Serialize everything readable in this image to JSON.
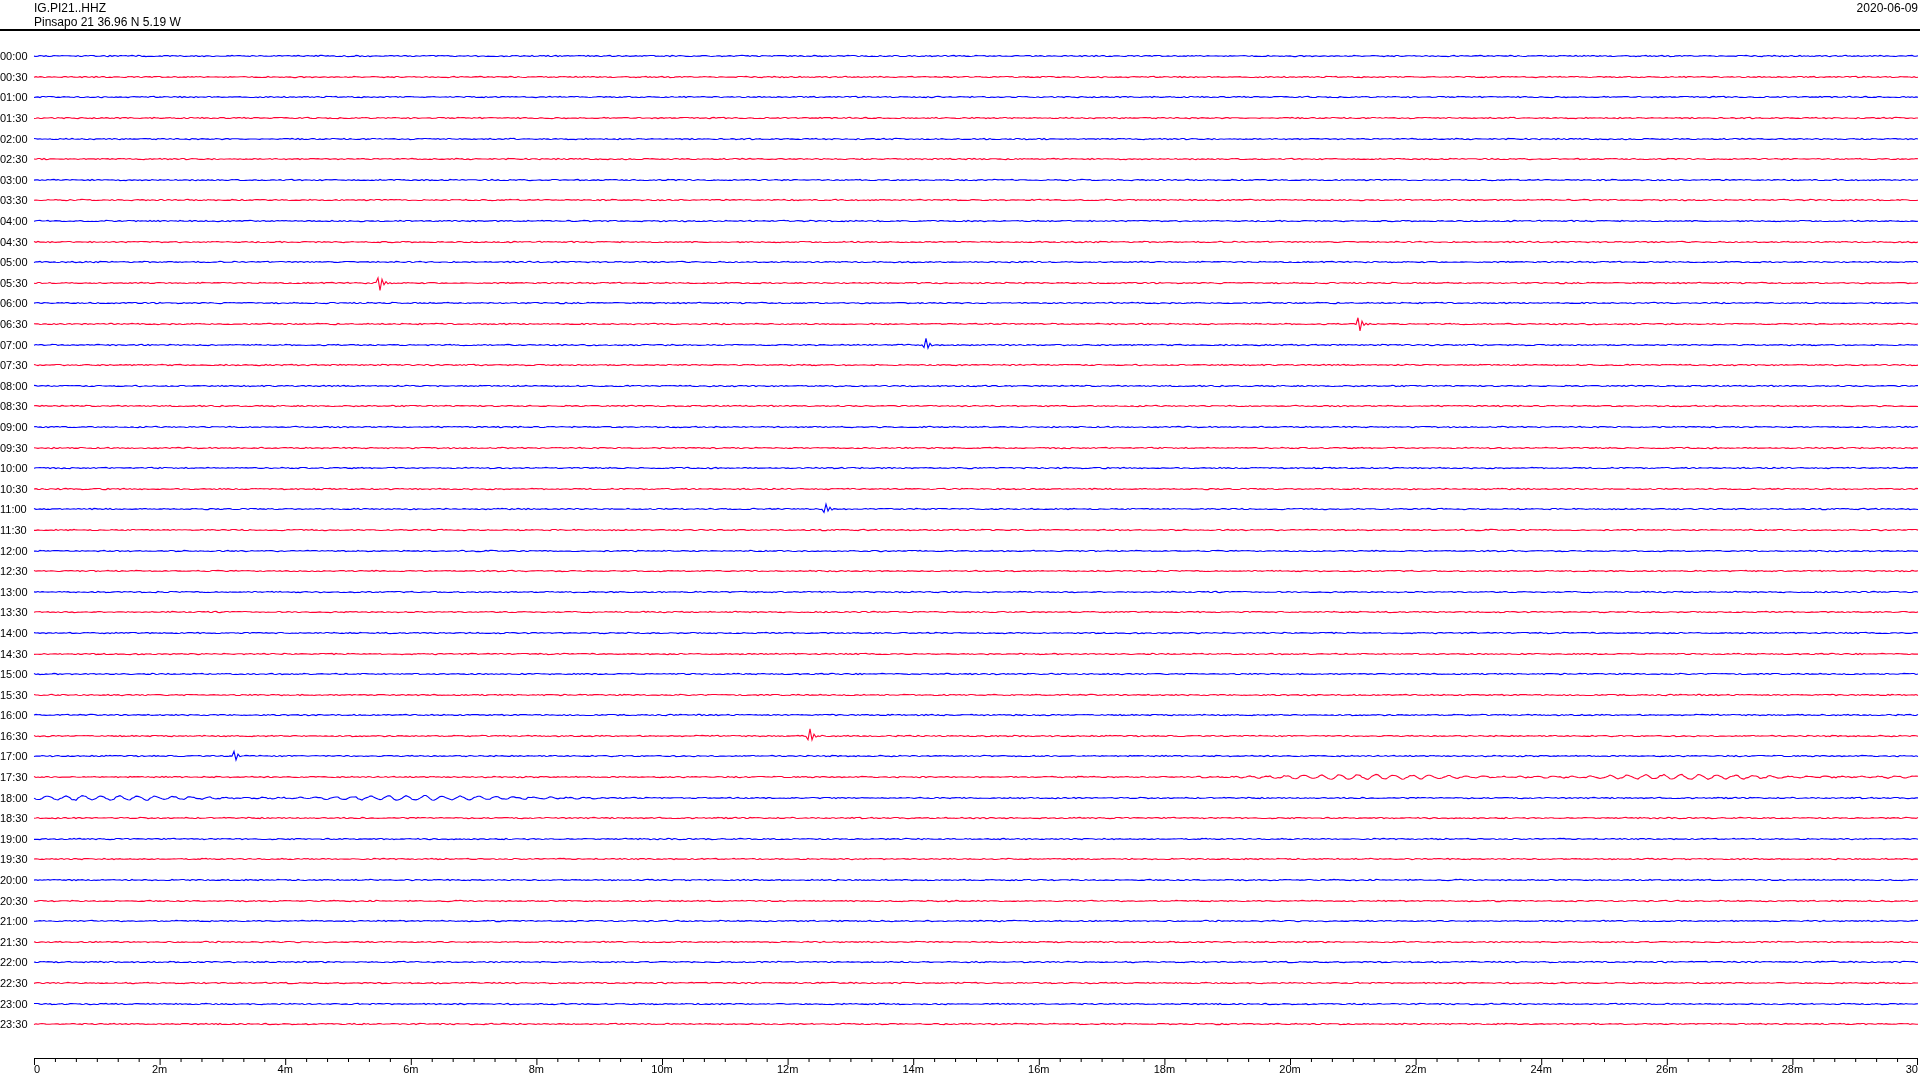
{
  "header": {
    "channel": "IG.PI21..HHZ",
    "station": "Pinsapo 21  36.96 N 5.19 W",
    "date": "2020-06-09"
  },
  "rows": [
    {
      "time": "00:00",
      "color": "#0000ff"
    },
    {
      "time": "00:30",
      "color": "#ff0033"
    },
    {
      "time": "01:00",
      "color": "#0000ff"
    },
    {
      "time": "01:30",
      "color": "#ff0033"
    },
    {
      "time": "02:00",
      "color": "#0000ff"
    },
    {
      "time": "02:30",
      "color": "#ff0033"
    },
    {
      "time": "03:00",
      "color": "#0000ff"
    },
    {
      "time": "03:30",
      "color": "#ff0033"
    },
    {
      "time": "04:00",
      "color": "#0000ff"
    },
    {
      "time": "04:30",
      "color": "#ff0033"
    },
    {
      "time": "05:00",
      "color": "#0000ff"
    },
    {
      "time": "05:30",
      "color": "#ff0033"
    },
    {
      "time": "06:00",
      "color": "#0000ff"
    },
    {
      "time": "06:30",
      "color": "#ff0033"
    },
    {
      "time": "07:00",
      "color": "#0000ff"
    },
    {
      "time": "07:30",
      "color": "#ff0033"
    },
    {
      "time": "08:00",
      "color": "#0000ff"
    },
    {
      "time": "08:30",
      "color": "#ff0033"
    },
    {
      "time": "09:00",
      "color": "#0000ff"
    },
    {
      "time": "09:30",
      "color": "#ff0033"
    },
    {
      "time": "10:00",
      "color": "#0000ff"
    },
    {
      "time": "10:30",
      "color": "#ff0033"
    },
    {
      "time": "11:00",
      "color": "#0000ff"
    },
    {
      "time": "11:30",
      "color": "#ff0033"
    },
    {
      "time": "12:00",
      "color": "#0000ff"
    },
    {
      "time": "12:30",
      "color": "#ff0033"
    },
    {
      "time": "13:00",
      "color": "#0000ff"
    },
    {
      "time": "13:30",
      "color": "#ff0033"
    },
    {
      "time": "14:00",
      "color": "#0000ff"
    },
    {
      "time": "14:30",
      "color": "#ff0033"
    },
    {
      "time": "15:00",
      "color": "#0000ff"
    },
    {
      "time": "15:30",
      "color": "#ff0033"
    },
    {
      "time": "16:00",
      "color": "#0000ff"
    },
    {
      "time": "16:30",
      "color": "#ff0033"
    },
    {
      "time": "17:00",
      "color": "#0000ff"
    },
    {
      "time": "17:30",
      "color": "#ff0033"
    },
    {
      "time": "18:00",
      "color": "#0000ff"
    },
    {
      "time": "18:30",
      "color": "#ff0033"
    },
    {
      "time": "19:00",
      "color": "#0000ff"
    },
    {
      "time": "19:30",
      "color": "#ff0033"
    },
    {
      "time": "20:00",
      "color": "#0000ff"
    },
    {
      "time": "20:30",
      "color": "#ff0033"
    },
    {
      "time": "21:00",
      "color": "#0000ff"
    },
    {
      "time": "21:30",
      "color": "#ff0033"
    },
    {
      "time": "22:00",
      "color": "#0000ff"
    },
    {
      "time": "22:30",
      "color": "#ff0033"
    },
    {
      "time": "23:00",
      "color": "#0000ff"
    },
    {
      "time": "23:30",
      "color": "#ff0033"
    }
  ],
  "time_axis": {
    "labels": [
      "0",
      "2m",
      "4m",
      "6m",
      "8m",
      "10m",
      "12m",
      "14m",
      "16m",
      "18m",
      "20m",
      "22m",
      "24m",
      "26m",
      "28m",
      "30"
    ]
  }
}
